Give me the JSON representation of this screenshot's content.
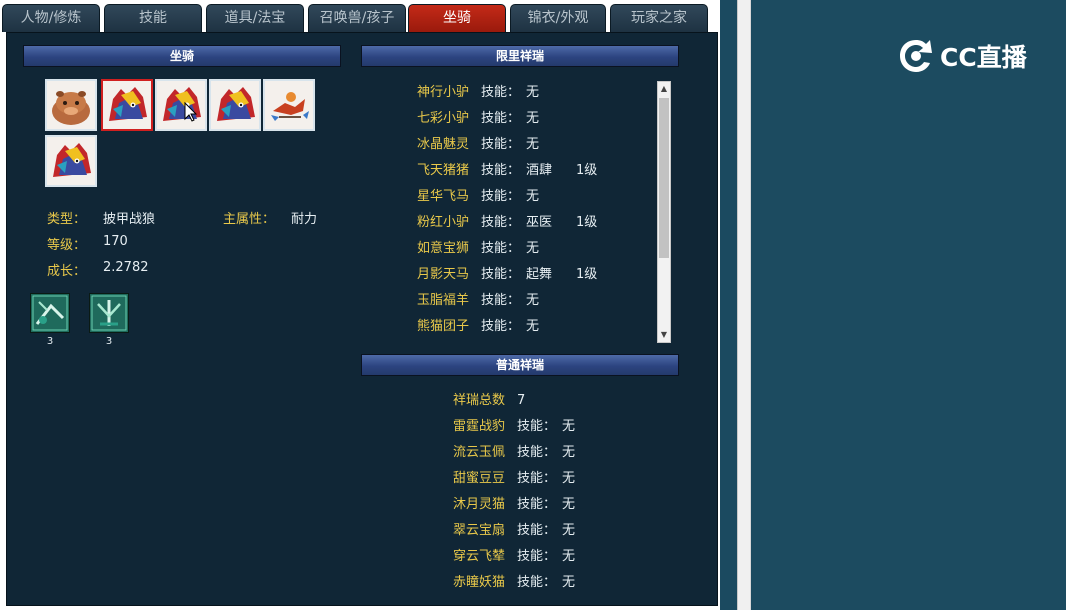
{
  "tabs": [
    {
      "label": "人物/修炼",
      "active": false
    },
    {
      "label": "技能",
      "active": false
    },
    {
      "label": "道具/法宝",
      "active": false
    },
    {
      "label": "召唤兽/孩子",
      "active": false
    },
    {
      "label": "坐骑",
      "active": true
    },
    {
      "label": "锦衣/外观",
      "active": false
    },
    {
      "label": "玩家之家",
      "active": false
    }
  ],
  "mount_panel": {
    "header": "坐骑",
    "slots": [
      {
        "icon": "capybara-mount-icon",
        "selected": false
      },
      {
        "icon": "armored-wolf-mount-icon",
        "selected": true
      },
      {
        "icon": "armored-wolf-mount-icon",
        "selected": false
      },
      {
        "icon": "armored-wolf-mount-icon",
        "selected": false
      },
      {
        "icon": "bird-mount-icon",
        "selected": false
      },
      {
        "icon": "armored-wolf-mount-icon",
        "selected": false
      }
    ],
    "type_label": "类型：",
    "type_value": "披甲战狼",
    "attr_label": "主属性：",
    "attr_value": "耐力",
    "level_label": "等级：",
    "level_value": "170",
    "growth_label": "成长：",
    "growth_value": "2.2782",
    "skills": [
      {
        "icon": "mount-skill-icon",
        "level": "3"
      },
      {
        "icon": "mount-skill-icon",
        "level": "3"
      }
    ]
  },
  "limited": {
    "header": "限里祥瑞",
    "rows": [
      {
        "name": "神行小驴",
        "skill_label": "技能：",
        "skill": "无",
        "level": ""
      },
      {
        "name": "七彩小驴",
        "skill_label": "技能：",
        "skill": "无",
        "level": ""
      },
      {
        "name": "冰晶魅灵",
        "skill_label": "技能：",
        "skill": "无",
        "level": ""
      },
      {
        "name": "飞天猪猪",
        "skill_label": "技能：",
        "skill": "酒肆",
        "level": "1级"
      },
      {
        "name": "星华飞马",
        "skill_label": "技能：",
        "skill": "无",
        "level": ""
      },
      {
        "name": "粉红小驴",
        "skill_label": "技能：",
        "skill": "巫医",
        "level": "1级"
      },
      {
        "name": "如意宝狮",
        "skill_label": "技能：",
        "skill": "无",
        "level": ""
      },
      {
        "name": "月影天马",
        "skill_label": "技能：",
        "skill": "起舞",
        "level": "1级"
      },
      {
        "name": "玉脂福羊",
        "skill_label": "技能：",
        "skill": "无",
        "level": ""
      },
      {
        "name": "熊猫团子",
        "skill_label": "技能：",
        "skill": "无",
        "level": ""
      }
    ]
  },
  "normal": {
    "header": "普通祥瑞",
    "total_label": "祥瑞总数",
    "total_value": "7",
    "rows": [
      {
        "name": "雷霆战豹",
        "skill_label": "技能：",
        "skill": "无"
      },
      {
        "name": "流云玉佩",
        "skill_label": "技能：",
        "skill": "无"
      },
      {
        "name": "甜蜜豆豆",
        "skill_label": "技能：",
        "skill": "无"
      },
      {
        "name": "沐月灵猫",
        "skill_label": "技能：",
        "skill": "无"
      },
      {
        "name": "翠云宝扇",
        "skill_label": "技能：",
        "skill": "无"
      },
      {
        "name": "穿云飞辇",
        "skill_label": "技能：",
        "skill": "无"
      },
      {
        "name": "赤瞳妖猫",
        "skill_label": "技能：",
        "skill": "无"
      }
    ]
  },
  "overlay": {
    "logo_text": "CC直播",
    "logo_icon": "cc-live-logo-icon"
  },
  "colors": {
    "accent_tab": "#c42a18",
    "name_gold": "#e8c84a",
    "panel_bg": "#102636"
  }
}
